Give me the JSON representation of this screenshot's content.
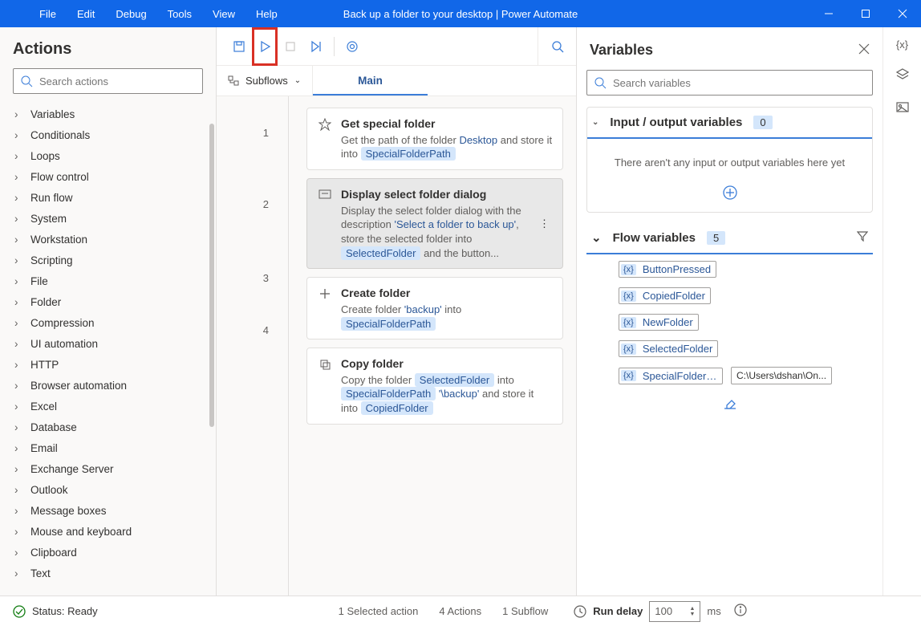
{
  "titlebar": {
    "menu": [
      "File",
      "Edit",
      "Debug",
      "Tools",
      "View",
      "Help"
    ],
    "title": "Back up a folder to your desktop | Power Automate"
  },
  "actions": {
    "header": "Actions",
    "search_placeholder": "Search actions",
    "tree": [
      "Variables",
      "Conditionals",
      "Loops",
      "Flow control",
      "Run flow",
      "System",
      "Workstation",
      "Scripting",
      "File",
      "Folder",
      "Compression",
      "UI automation",
      "HTTP",
      "Browser automation",
      "Excel",
      "Database",
      "Email",
      "Exchange Server",
      "Outlook",
      "Message boxes",
      "Mouse and keyboard",
      "Clipboard",
      "Text"
    ]
  },
  "toolbar": {
    "subflows_label": "Subflows",
    "main_tab": "Main"
  },
  "steps": {
    "s1": {
      "title": "Get special folder",
      "pre": "Get the path of the folder ",
      "link": "Desktop",
      "mid": " and store it into ",
      "pill": "SpecialFolderPath"
    },
    "s2": {
      "title": "Display select folder dialog",
      "line1": "Display the select folder dialog with the description ",
      "quote": "'Select a folder to back up'",
      "line2": ", store the selected folder into ",
      "pill": "SelectedFolder",
      "tail": " and the button..."
    },
    "s3": {
      "title": "Create folder",
      "pre": "Create folder ",
      "quote": "'backup'",
      "mid": " into ",
      "pill": "SpecialFolderPath"
    },
    "s4": {
      "title": "Copy folder",
      "pre": "Copy the folder ",
      "pill1": "SelectedFolder",
      "mid1": " into ",
      "pill2": "SpecialFolderPath",
      "quote": "'\\backup'",
      "mid2": " and store it into ",
      "pill3": "CopiedFolder"
    }
  },
  "variables": {
    "header": "Variables",
    "search_placeholder": "Search variables",
    "io_section_label": "Input / output variables",
    "io_count": "0",
    "io_empty": "There aren't any input or output variables here yet",
    "flow_section_label": "Flow variables",
    "flow_count": "5",
    "flowvars": [
      "ButtonPressed",
      "CopiedFolder",
      "NewFolder",
      "SelectedFolder",
      "SpecialFolderP..."
    ],
    "special_value": "C:\\Users\\dshan\\On..."
  },
  "status": {
    "text": "Status: Ready",
    "selected": "1 Selected action",
    "actions_count": "4 Actions",
    "subflows": "1 Subflow",
    "run_delay_label": "Run delay",
    "run_delay_value": "100",
    "run_delay_unit": "ms"
  }
}
